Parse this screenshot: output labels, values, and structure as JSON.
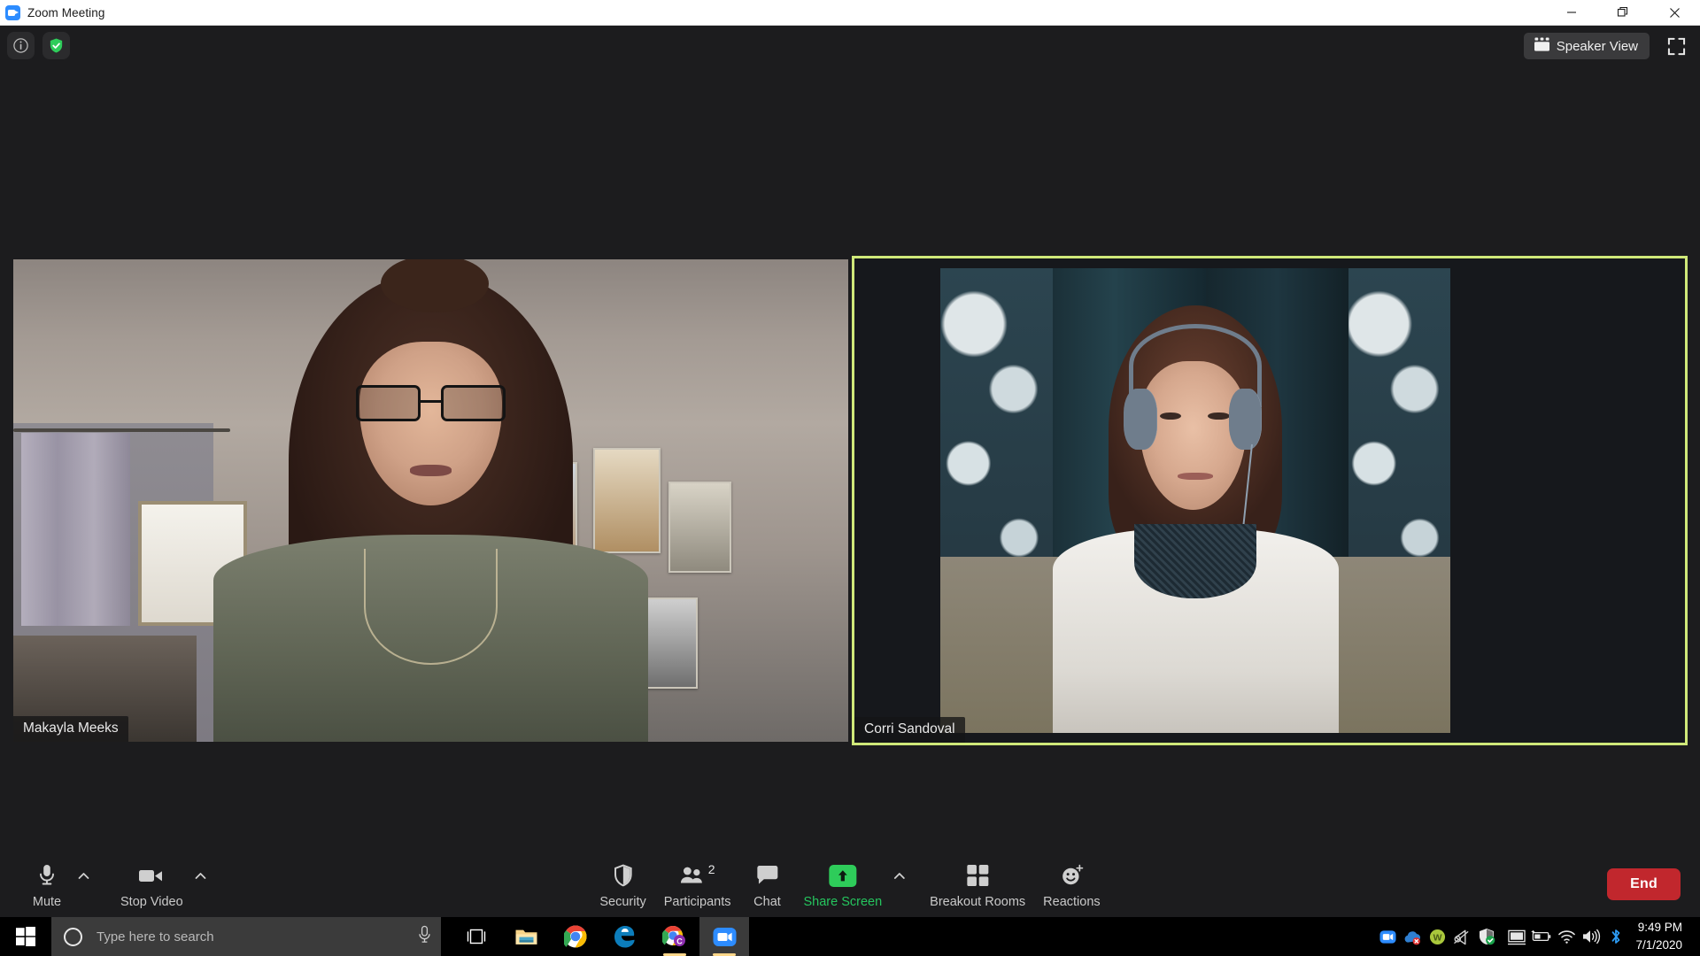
{
  "window": {
    "title": "Zoom Meeting",
    "app_icon": "zoom-video-icon",
    "minimize_label": "Minimize",
    "restore_label": "Restore",
    "close_label": "Close"
  },
  "topbar": {
    "info_icon": "info-icon",
    "encryption_icon": "shield-check-icon",
    "view_mode": "Speaker View",
    "view_icon": "gallery-view-icon",
    "fullscreen_icon": "enter-fullscreen-icon"
  },
  "stage": {
    "active_speaker_border_color": "#cfe879",
    "participants": [
      {
        "name": "Makayla Meeks",
        "position": "left",
        "active_speaker": false
      },
      {
        "name": "Corri Sandoval",
        "position": "right",
        "active_speaker": true
      }
    ]
  },
  "toolbar": {
    "left": [
      {
        "label": "Mute",
        "icon": "microphone-icon",
        "has_caret": true
      },
      {
        "label": "Stop Video",
        "icon": "video-camera-icon",
        "has_caret": true
      }
    ],
    "center": [
      {
        "label": "Security",
        "icon": "shield-icon",
        "has_caret": false,
        "badge": ""
      },
      {
        "label": "Participants",
        "icon": "people-icon",
        "has_caret": false,
        "badge": "2"
      },
      {
        "label": "Chat",
        "icon": "chat-bubble-icon",
        "has_caret": false,
        "badge": ""
      },
      {
        "label": "Share Screen",
        "icon": "share-screen-up-arrow-icon",
        "has_caret": true,
        "badge": "",
        "highlight": true
      },
      {
        "label": "Breakout Rooms",
        "icon": "breakout-rooms-grid-icon",
        "has_caret": false,
        "badge": ""
      },
      {
        "label": "Reactions",
        "icon": "reactions-smiley-plus-icon",
        "has_caret": false,
        "badge": ""
      }
    ],
    "end_label": "End",
    "end_color": "#c1272d",
    "share_accent": "#2ecc5a"
  },
  "taskbar": {
    "start_icon": "windows-start-icon",
    "search_placeholder": "Type here to search",
    "cortana_icon": "cortana-circle-icon",
    "microphone_icon": "microphone-icon",
    "apps": [
      {
        "name": "task-view-icon",
        "active": false,
        "running": false
      },
      {
        "name": "file-explorer-icon",
        "active": false,
        "running": false
      },
      {
        "name": "google-chrome-icon",
        "active": false,
        "running": false
      },
      {
        "name": "microsoft-edge-icon",
        "active": false,
        "running": false
      },
      {
        "name": "chrome-canary-icon",
        "active": false,
        "running": true
      },
      {
        "name": "zoom-icon",
        "active": true,
        "running": true
      }
    ],
    "tray": [
      "zoom-tray-icon",
      "onedrive-error-icon",
      "webex-icon",
      "speaker-muted-icon",
      "windows-defender-icon",
      "display-icon",
      "battery-charging-icon",
      "wifi-icon",
      "volume-icon",
      "bluetooth-icon"
    ],
    "clock_time": "9:49 PM",
    "clock_date": "7/1/2020"
  }
}
